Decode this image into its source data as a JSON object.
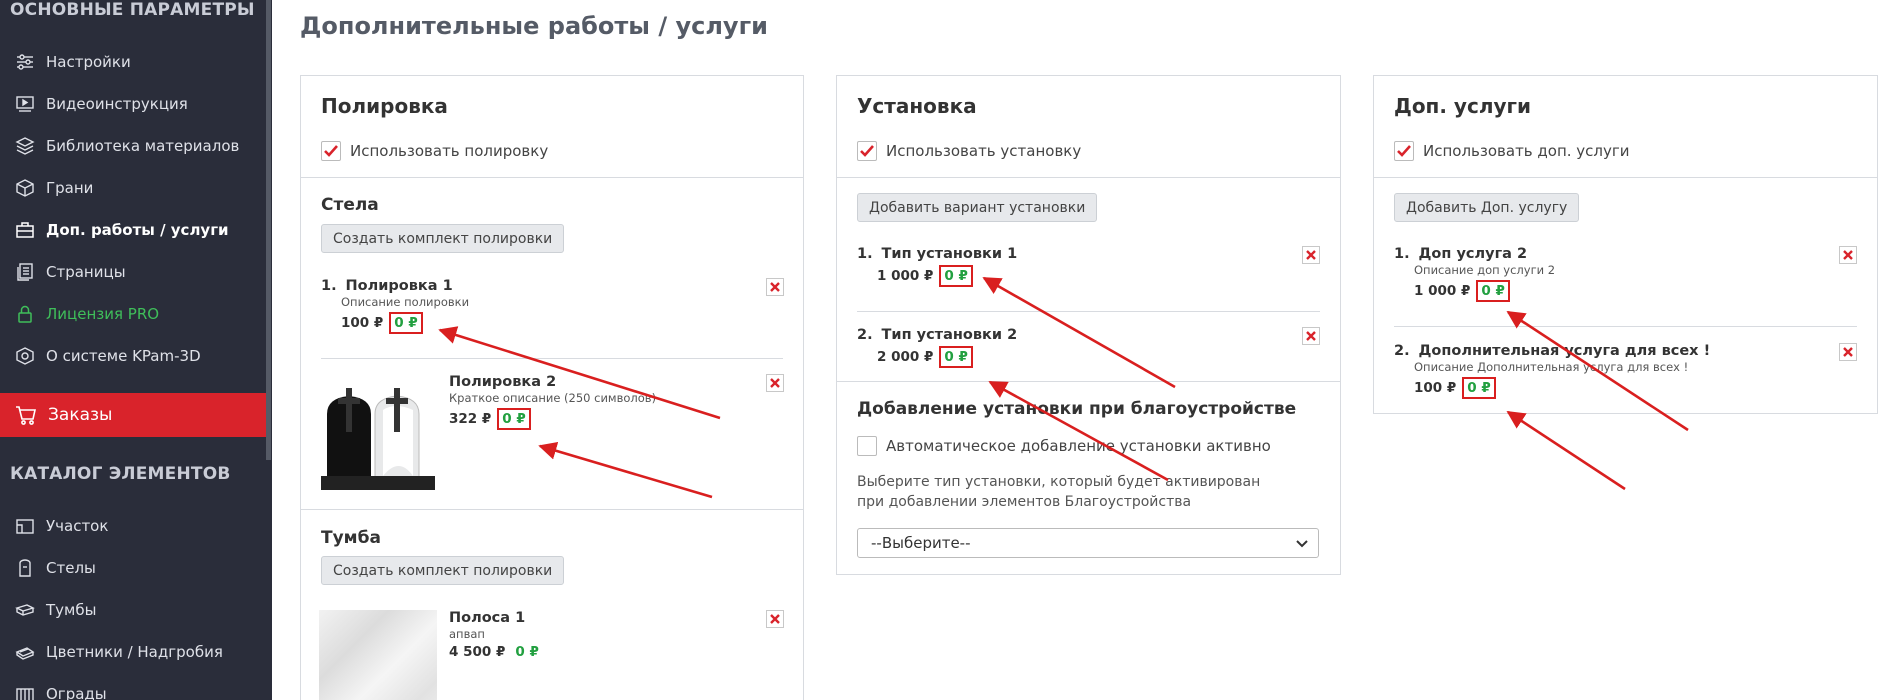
{
  "sidebar": {
    "section_main": "ОСНОВНЫЕ ПАРАМЕТРЫ",
    "items": [
      {
        "label": "Настройки",
        "icon": "sliders-icon"
      },
      {
        "label": "Видеоинструкция",
        "icon": "video-icon"
      },
      {
        "label": "Библиотека материалов",
        "icon": "layers-icon"
      },
      {
        "label": "Грани",
        "icon": "cube-icon"
      },
      {
        "label": "Доп. работы / услуги",
        "icon": "briefcase-icon"
      },
      {
        "label": "Страницы",
        "icon": "pages-icon"
      },
      {
        "label": "Лицензия PRO",
        "icon": "lock-icon"
      },
      {
        "label": "О системе KPam-3D",
        "icon": "info-icon"
      }
    ],
    "orders_label": "Заказы",
    "section_catalog": "КАТАЛОГ ЭЛЕМЕНТОВ",
    "catalog": [
      {
        "label": "Участок",
        "icon": "plot-icon"
      },
      {
        "label": "Стелы",
        "icon": "stele-icon"
      },
      {
        "label": "Тумбы",
        "icon": "pedestal-icon"
      },
      {
        "label": "Цветники / Надгробия",
        "icon": "flowerbed-icon"
      },
      {
        "label": "Ограды",
        "icon": "fence-icon"
      }
    ],
    "accent_color": "#d9232b",
    "pro_color": "#3fbf5a"
  },
  "page_title": "Дополнительные работы / услуги",
  "polish": {
    "title": "Полировка",
    "use_label": "Использовать полировку",
    "stela": {
      "title": "Стела",
      "create_btn": "Создать комплект полировки",
      "items": [
        {
          "num": "1.",
          "name": "Полировка 1",
          "desc": "Описание полировки",
          "price": "100 ₽",
          "extra": "0 ₽"
        },
        {
          "name": "Полировка 2",
          "desc": "Краткое описание (250 символов)",
          "price": "322 ₽",
          "extra": "0 ₽"
        }
      ]
    },
    "tumba": {
      "title": "Тумба",
      "create_btn": "Создать комплект полировки",
      "items": [
        {
          "name": "Полоса 1",
          "desc": "апвап",
          "price": "4 500 ₽",
          "extra": "0 ₽"
        }
      ]
    }
  },
  "install": {
    "title": "Установка",
    "use_label": "Использовать установку",
    "add_btn": "Добавить вариант установки",
    "items": [
      {
        "num": "1.",
        "name": "Тип установки 1",
        "price": "1 000 ₽",
        "extra": "0 ₽"
      },
      {
        "num": "2.",
        "name": "Тип установки 2",
        "price": "2 000 ₽",
        "extra": "0 ₽"
      }
    ],
    "landscaping_title": "Добавление установки при благоустройстве",
    "auto_label": "Автоматическое добавление установки активно",
    "help": "Выберите тип установки, который будет активирован при добавлении элементов Благоустройства",
    "select_value": "--Выберите--"
  },
  "extra": {
    "title": "Доп. услуги",
    "use_label": "Использовать доп. услуги",
    "add_btn": "Добавить Доп. услугу",
    "items": [
      {
        "num": "1.",
        "name": "Доп услуга 2",
        "desc": "Описание доп услуги 2",
        "price": "1 000 ₽",
        "extra": "0 ₽"
      },
      {
        "num": "2.",
        "name": "Дополнительная услуга для всех !",
        "desc": "Описание Дополнительная услуга для всех !",
        "price": "100 ₽",
        "extra": "0 ₽"
      }
    ]
  },
  "annotation_color": "#d91f1f",
  "zero_color": "#22a040"
}
